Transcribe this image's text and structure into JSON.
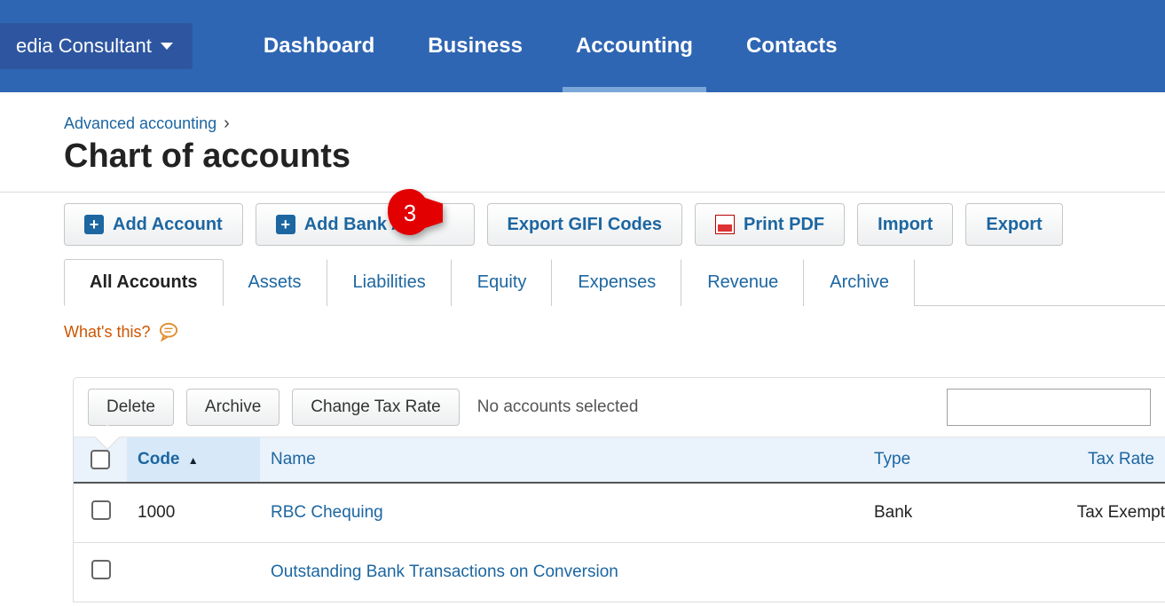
{
  "top": {
    "org": "edia Consultant",
    "nav": [
      "Dashboard",
      "Business",
      "Accounting",
      "Contacts"
    ],
    "active": 2
  },
  "breadcrumb": "Advanced accounting",
  "title": "Chart of accounts",
  "toolbar": {
    "addAccount": "Add Account",
    "addBank": "Add Bank Acc",
    "exportGifi": "Export GIFI Codes",
    "printPdf": "Print PDF",
    "import": "Import",
    "export": "Export"
  },
  "callout": "3",
  "tabs": {
    "items": [
      "All Accounts",
      "Assets",
      "Liabilities",
      "Equity",
      "Expenses",
      "Revenue",
      "Archive"
    ],
    "active": 0
  },
  "whats": "What's this?",
  "tableToolbar": {
    "delete": "Delete",
    "archive": "Archive",
    "changeTax": "Change Tax Rate",
    "status": "No accounts selected"
  },
  "columns": {
    "code": "Code",
    "name": "Name",
    "type": "Type",
    "taxRate": "Tax Rate"
  },
  "rows": [
    {
      "code": "1000",
      "name": "RBC Chequing",
      "type": "Bank",
      "taxRate": "Tax Exempt"
    },
    {
      "code": "",
      "name": "Outstanding Bank Transactions on Conversion",
      "type": "",
      "taxRate": ""
    }
  ]
}
